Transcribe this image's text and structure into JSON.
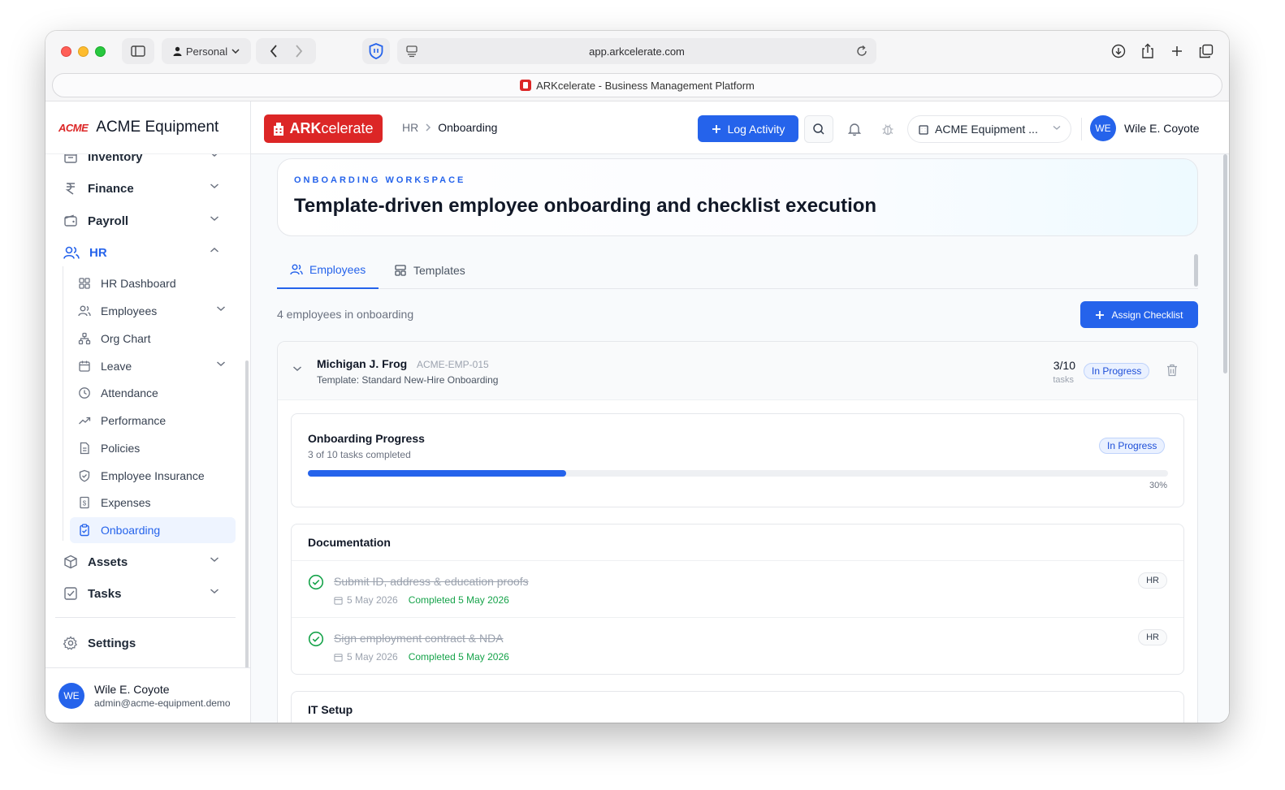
{
  "browser": {
    "profile": "Personal",
    "url": "app.arkcelerate.com",
    "tab_title": "ARKcelerate - Business Management Platform"
  },
  "sidebar": {
    "logo_text": "ACME",
    "company": "ACME Equipment",
    "items": {
      "inventory": "Inventory",
      "finance": "Finance",
      "payroll": "Payroll",
      "hr": "HR",
      "assets": "Assets",
      "tasks": "Tasks",
      "settings": "Settings"
    },
    "hr_sub": {
      "dashboard": "HR Dashboard",
      "employees": "Employees",
      "org_chart": "Org Chart",
      "leave": "Leave",
      "attendance": "Attendance",
      "performance": "Performance",
      "policies": "Policies",
      "insurance": "Employee Insurance",
      "expenses": "Expenses",
      "onboarding": "Onboarding"
    },
    "user": {
      "initials": "WE",
      "name": "Wile E. Coyote",
      "email": "admin@acme-equipment.demo"
    }
  },
  "topbar": {
    "logo_ark": "ARK",
    "logo_rest": "celerate",
    "crumb_parent": "HR",
    "crumb_current": "Onboarding",
    "log_activity": "Log Activity",
    "company_select": "ACME Equipment ...",
    "user_initials": "WE",
    "user_name": "Wile E. Coyote"
  },
  "hero": {
    "eyebrow": "ONBOARDING WORKSPACE",
    "title": "Template-driven employee onboarding and checklist execution"
  },
  "tabs": {
    "employees": "Employees",
    "templates": "Templates"
  },
  "list": {
    "count_text": "4 employees in onboarding",
    "assign_button": "Assign Checklist"
  },
  "employee": {
    "name": "Michigan J. Frog",
    "id": "ACME-EMP-015",
    "template": "Template: Standard New-Hire Onboarding",
    "task_count": "3/10",
    "task_label": "tasks",
    "status": "In Progress"
  },
  "progress": {
    "title": "Onboarding Progress",
    "subtitle": "3 of 10 tasks completed",
    "status": "In Progress",
    "percent_label": "30%",
    "percent": 30
  },
  "documentation": {
    "title": "Documentation",
    "tasks": [
      {
        "title": "Submit ID, address & education proofs",
        "date": "5 May 2026",
        "completed": "Completed 5 May 2026",
        "role": "HR"
      },
      {
        "title": "Sign employment contract & NDA",
        "date": "5 May 2026",
        "completed": "Completed 5 May 2026",
        "role": "HR"
      }
    ]
  },
  "it_setup": {
    "title": "IT Setup"
  },
  "colors": {
    "accent": "#2563eb",
    "brand_red": "#dc2626",
    "success": "#16a34a"
  }
}
